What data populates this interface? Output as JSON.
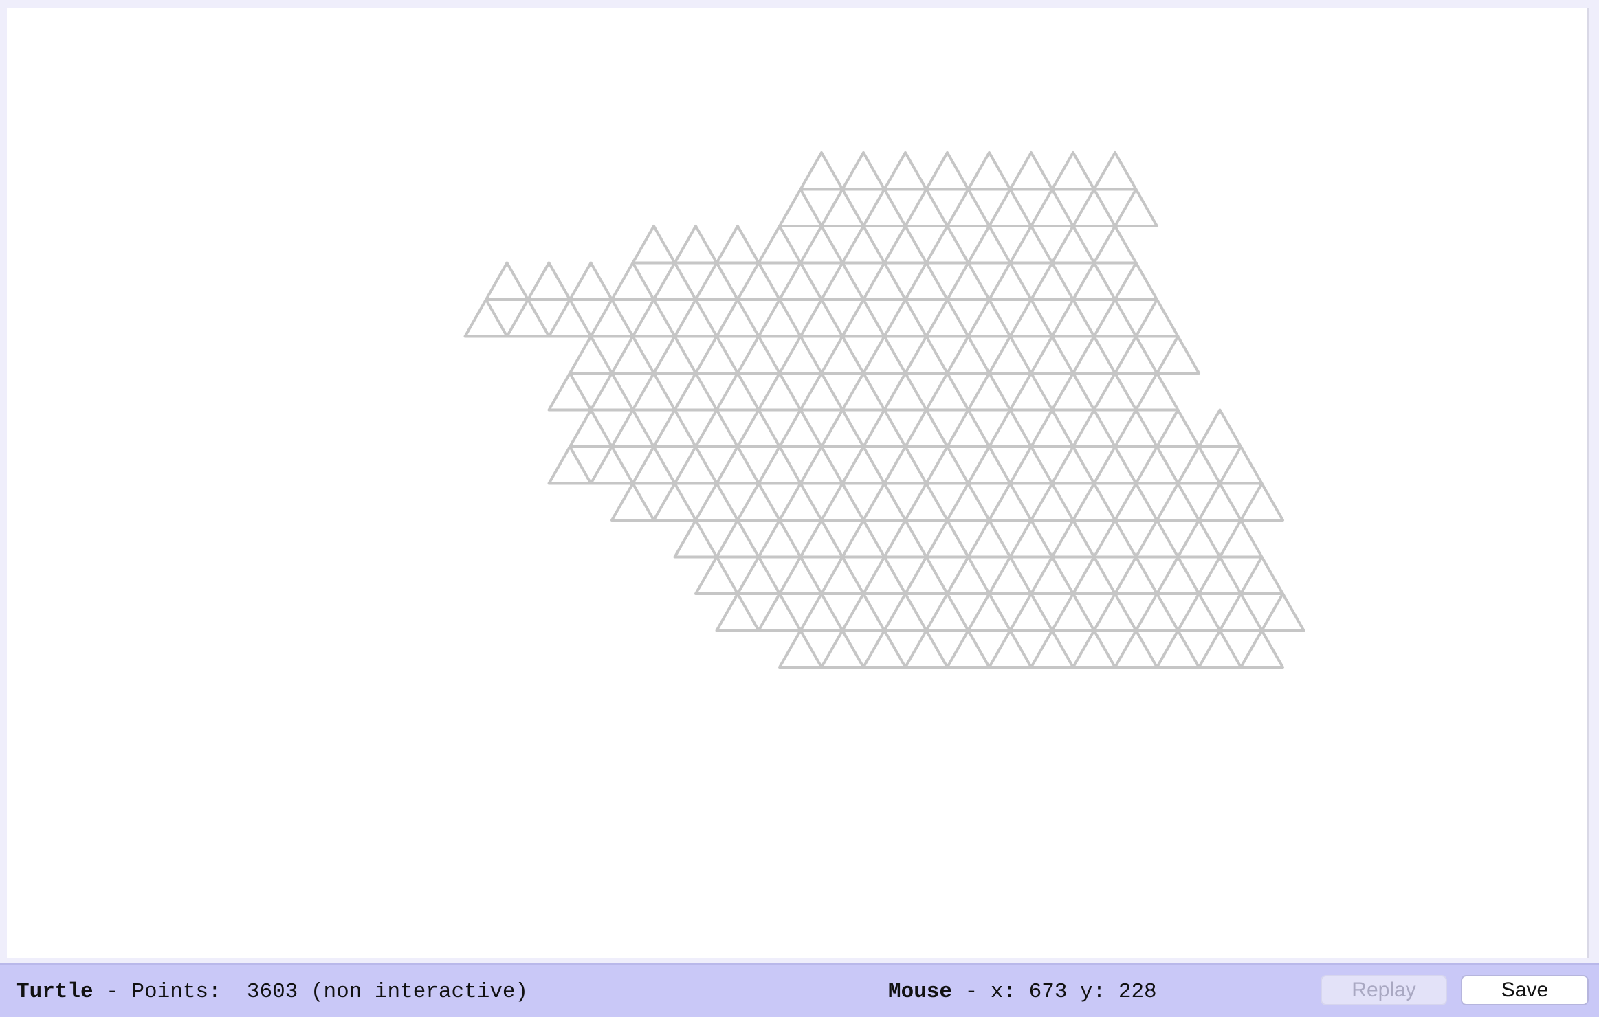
{
  "status": {
    "turtle_label": "Turtle",
    "points_text": " - Points:  3603 (non interactive)",
    "mouse_label": "Mouse",
    "mouse_text": " - x: 673 y: 228"
  },
  "buttons": {
    "replay": "Replay",
    "save": "Save"
  },
  "drawing": {
    "stroke_color": "#c6c6c6",
    "background": "#ffffff"
  }
}
